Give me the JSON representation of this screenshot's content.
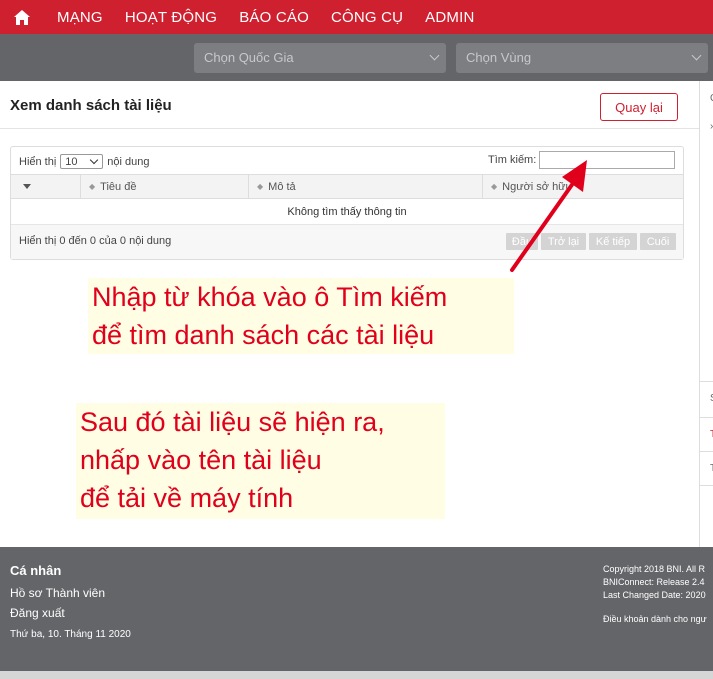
{
  "nav": {
    "items": [
      "MẠNG",
      "HOẠT ĐỘNG",
      "BÁO CÁO",
      "CÔNG CỤ",
      "ADMIN"
    ],
    "home_icon": "home-icon",
    "bg_color": "#cf2030"
  },
  "filters": {
    "country_placeholder": "Chọn Quốc Gia",
    "region_placeholder": "Chọn Vùng"
  },
  "page": {
    "title": "Xem danh sách tài liệu",
    "back_label": "Quay lại"
  },
  "table": {
    "show_label": "Hiển thị",
    "page_size": "10",
    "entries_label": "nội dung",
    "search_label": "Tìm kiếm:",
    "columns": [
      "Tiêu đề",
      "Mô tả",
      "Người sở hữu"
    ],
    "empty_text": "Không tìm thấy thông tin",
    "info_text": "Hiển thị 0 đến 0 của 0 nội dung",
    "pager": [
      "Đầu",
      "Trở lại",
      "Kế tiếp",
      "Cuối"
    ]
  },
  "annotations": {
    "note1": [
      "Nhập từ khóa vào ô Tìm kiếm",
      "để tìm danh sách các tài liệu"
    ],
    "note2": [
      "Sau đó tài liệu sẽ hiện ra,",
      "nhấp vào tên tài liệu",
      "để tải về máy tính"
    ],
    "text_color": "#e0001b",
    "bg_color": "#fffde4"
  },
  "footer": {
    "heading": "Cá nhân",
    "profile_link": "Hồ sơ Thành viên",
    "logout_link": "Đăng xuất",
    "date": "Thứ ba, 10. Tháng 11 2020",
    "copyright": "Copyright 2018 BNI. All R",
    "release": "BNIConnect: Release 2.4",
    "changed": "Last Changed Date: 2020",
    "terms": "Điều khoản dành cho ngư"
  },
  "right_strip": [
    "C",
    "›",
    "S",
    "T",
    "T"
  ]
}
